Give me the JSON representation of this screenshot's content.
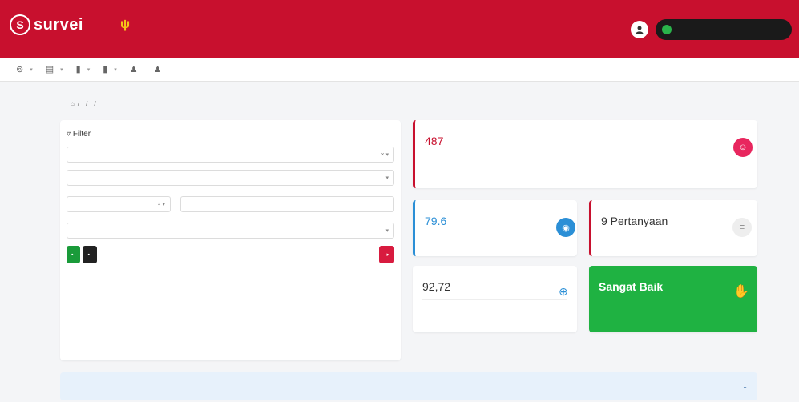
{
  "header": {
    "logo_mark": "S",
    "app_name": "survei",
    "app_sub": "",
    "partner_mark": "ψ",
    "partner_name": "",
    "user_name": "",
    "user_role": "",
    "unit_label": "",
    "brand_color": "#c8102e"
  },
  "nav": {
    "items": [
      {
        "label": "",
        "icon": "dashboard-icon"
      },
      {
        "label": "",
        "icon": "master-data-icon"
      },
      {
        "label": "",
        "icon": "report-icon"
      },
      {
        "label": "",
        "icon": "settings-icon"
      },
      {
        "label": "",
        "icon": "user-icon"
      },
      {
        "label": "",
        "icon": "user-icon"
      }
    ]
  },
  "breadcrumb": [
    "⌂",
    "",
    "",
    ""
  ],
  "filter": {
    "title": "Filter",
    "fields": {
      "provider": {
        "label": "",
        "value": ""
      },
      "service": {
        "label": "",
        "placeholder": ""
      },
      "year": {
        "label": "",
        "value": ""
      },
      "period": {
        "label": "",
        "value": ""
      },
      "service_type": {
        "label": "",
        "placeholder": ""
      }
    },
    "buttons": {
      "export": "",
      "download": "",
      "process": ""
    }
  },
  "stats": {
    "respondents": {
      "label": "",
      "value": "487",
      "note": ""
    },
    "cost": {
      "label": "",
      "value": "79.6"
    },
    "questions": {
      "label": "",
      "value": "9 Pertanyaan"
    },
    "score": {
      "label": "",
      "value": "92,72",
      "sub": ""
    },
    "quality": {
      "label": "",
      "value": "Sangat Baik",
      "sub": ""
    }
  },
  "accordion": {
    "label": ""
  }
}
